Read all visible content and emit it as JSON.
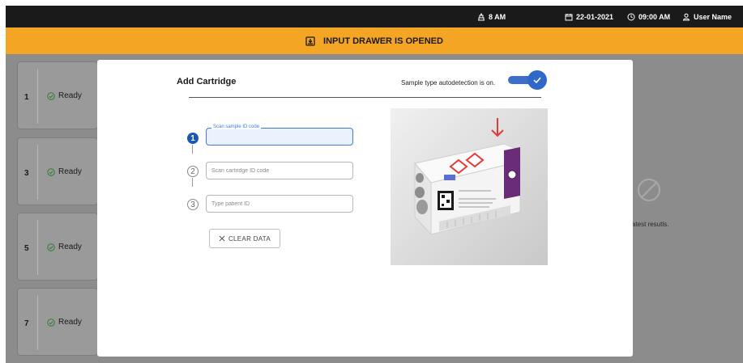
{
  "topbar": {
    "rack_status": "8 AM",
    "date": "22-01-2021",
    "time": "09:00 AM",
    "user": "User Name"
  },
  "banner": {
    "text": "INPUT DRAWER IS OPENED",
    "icon": "drawer-in-icon"
  },
  "modules": [
    {
      "number": "1",
      "status": "Ready"
    },
    {
      "number": "3",
      "status": "Ready"
    },
    {
      "number": "5",
      "status": "Ready"
    },
    {
      "number": "7",
      "status": "Ready"
    }
  ],
  "background_panel": {
    "text": "atest resutls."
  },
  "modal": {
    "title": "Add Cartridge",
    "autodetect_text": "Sample type autodetection is on.",
    "autodetect_on": true,
    "steps": [
      {
        "number": "1",
        "label": "Scan sample ID code",
        "placeholder": "",
        "active": true
      },
      {
        "number": "2",
        "label": "",
        "placeholder": "Scan cartridge ID code",
        "active": false
      },
      {
        "number": "3",
        "label": "",
        "placeholder": "Type patient ID",
        "active": false
      }
    ],
    "clear_button": "CLEAR DATA"
  },
  "colors": {
    "banner": "#f5a524",
    "topbar": "#1a1a1a",
    "accent": "#1b57b5",
    "status_ready": "#2e7d32",
    "hazard_red": "#e53935",
    "cartridge_purple": "#6a2b78"
  }
}
